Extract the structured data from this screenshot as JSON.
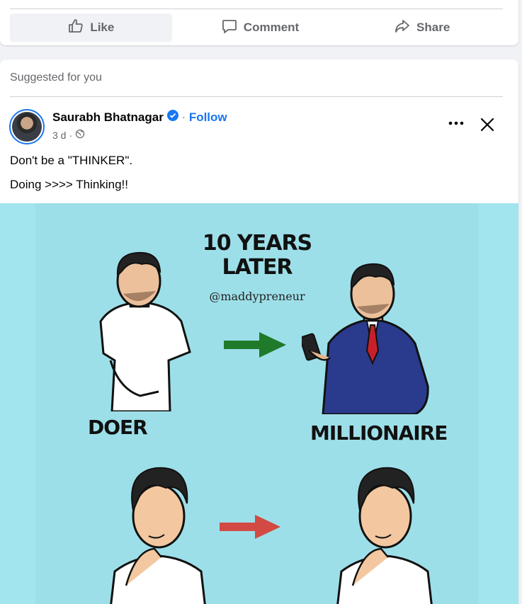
{
  "previous_post": {
    "actions": [
      {
        "label": "Like",
        "icon": "like-icon"
      },
      {
        "label": "Comment",
        "icon": "comment-icon"
      },
      {
        "label": "Share",
        "icon": "share-icon"
      }
    ]
  },
  "suggested": {
    "header": "Suggested for you",
    "author": "Saurabh Bhatnagar",
    "follow_label": "Follow",
    "separator": "·",
    "time": "3 d",
    "text_lines": [
      "Don't be a \"THINKER\".",
      "Doing >>>> Thinking!!"
    ],
    "image": {
      "title": "10 YEARS\nLATER",
      "handle": "@maddypreneur",
      "label_left": "DOER",
      "label_right": "MILLIONAIRE"
    }
  },
  "colors": {
    "accent": "#1877f2",
    "muted": "#65676b",
    "image_bg": "#a2e5ef",
    "arrow_green": "#1f7a2a",
    "arrow_red": "#d24a43"
  }
}
